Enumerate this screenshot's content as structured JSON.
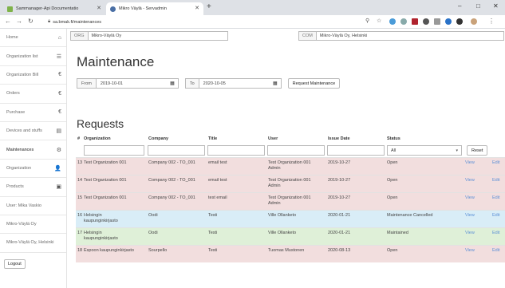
{
  "browser": {
    "tabs": [
      {
        "title": "Sammanager-Api Documentatio",
        "active": false
      },
      {
        "title": "Mikro Väylä - Servadmin",
        "active": true
      }
    ],
    "url": "sa.bmak.fi/maintenances",
    "controls": {
      "minimize": "–",
      "maximize": "□",
      "close": "✕"
    }
  },
  "sidebar": {
    "items": [
      {
        "label": "Home",
        "icon": "home-icon",
        "glyph": "⌂"
      },
      {
        "label": "Organization list",
        "icon": "list-icon",
        "glyph": "☰"
      },
      {
        "label": "Organization Bill",
        "icon": "euro-icon",
        "glyph": "€"
      },
      {
        "label": "Orders",
        "icon": "euro-icon",
        "glyph": "€"
      },
      {
        "label": "Purchase",
        "icon": "euro-icon",
        "glyph": "€"
      },
      {
        "label": "Devices and stuffs",
        "icon": "device-icon",
        "glyph": "▤"
      },
      {
        "label": "Maintenances",
        "icon": "gear-icon",
        "glyph": "⚙"
      },
      {
        "label": "Organization",
        "icon": "person-icon",
        "glyph": "👤"
      },
      {
        "label": "Products",
        "icon": "cube-icon",
        "glyph": "▣"
      },
      {
        "label": "User: Mika Vaskio",
        "icon": "",
        "glyph": ""
      },
      {
        "label": "Mikro-Väylä Oy",
        "icon": "",
        "glyph": ""
      },
      {
        "label": "Mikro-Väylä Oy, Helsinki",
        "icon": "",
        "glyph": ""
      }
    ],
    "logout": "Logout"
  },
  "context": {
    "org_label": "ORG",
    "org_value": "Mikro-Väylä Oy",
    "com_label": "COM",
    "com_value": "Mikro-Väylä Oy, Helsinki"
  },
  "maintenance": {
    "title": "Maintenance",
    "from_label": "From",
    "from_value": "2019-10-01",
    "to_label": "To",
    "to_value": "2020-10-05",
    "request_button": "Request Maintenance"
  },
  "requests": {
    "title": "Requests",
    "headers": {
      "hash": "#",
      "organization": "Organization",
      "company": "Company",
      "title": "Title",
      "user": "User",
      "issue_date": "Issue Date",
      "status": "Status"
    },
    "status_filter": "All",
    "reset": "Reset",
    "rows": [
      {
        "id": "13",
        "organization": "Test Organization 001",
        "company": "Company 002 - TO_001",
        "title": "email test",
        "user": "Test Organization 001 Admin",
        "date": "2019-10-27",
        "status": "Open",
        "view": "View",
        "edit": "Edit",
        "color": "#f2dede"
      },
      {
        "id": "14",
        "organization": "Test Organization 001",
        "company": "Company 002 - TO_001",
        "title": "email test",
        "user": "Test Organization 001 Admin",
        "date": "2019-10-27",
        "status": "Open",
        "view": "View",
        "edit": "Edit",
        "color": "#f2dede"
      },
      {
        "id": "15",
        "organization": "Test Organization 001",
        "company": "Company 002 - TO_001",
        "title": "test email",
        "user": "Test Organization 001 Admin",
        "date": "2019-10-27",
        "status": "Open",
        "view": "View",
        "edit": "Edit",
        "color": "#f2dede"
      },
      {
        "id": "16",
        "organization": "Helsingin kaupunginkirjasto",
        "company": "Oodi",
        "title": "Testi",
        "user": "Ville Ollanketo",
        "date": "2020-01-21",
        "status": "Maintenance Cancelled",
        "view": "View",
        "edit": "Edit",
        "color": "#d9edf7"
      },
      {
        "id": "17",
        "organization": "Helsingin kaupunginkirjasto",
        "company": "Oodi",
        "title": "Testi",
        "user": "Ville Ollanketo",
        "date": "2020-01-21",
        "status": "Maintained",
        "view": "View",
        "edit": "Edit",
        "color": "#dff0d8"
      },
      {
        "id": "18",
        "organization": "Espoon kaupunginkirjasto",
        "company": "Sourpello",
        "title": "Testi",
        "user": "Tuomas Mustonen",
        "date": "2020-08-13",
        "status": "Open",
        "view": "View",
        "edit": "Edit",
        "color": "#f2dede"
      }
    ]
  },
  "colors": {
    "link": "#5b8fd6",
    "open": "#f2dede",
    "cancelled": "#d9edf7",
    "maintained": "#dff0d8"
  }
}
